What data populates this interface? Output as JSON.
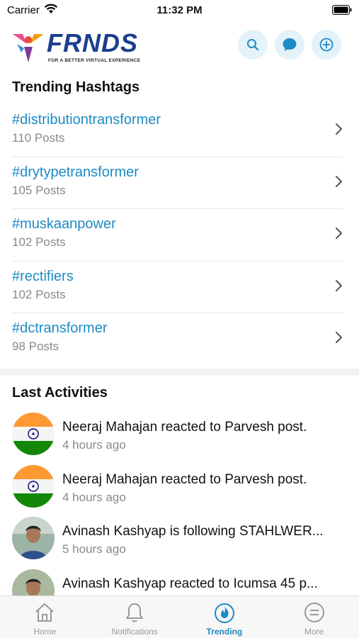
{
  "status_bar": {
    "carrier": "Carrier",
    "time": "11:32 PM"
  },
  "header": {
    "brand": "FRNDS",
    "tagline": "FOR A BETTER VIRTUAL EXPERIENCE",
    "actions": [
      "search-icon",
      "chat-icon",
      "add-circle-icon"
    ]
  },
  "trending": {
    "title": "Trending Hashtags",
    "items": [
      {
        "tag": "#distributiontransformer",
        "count": "110 Posts"
      },
      {
        "tag": "#drytypetransformer",
        "count": "105 Posts"
      },
      {
        "tag": "#muskaanpower",
        "count": "102 Posts"
      },
      {
        "tag": "#rectifiers",
        "count": "102 Posts"
      },
      {
        "tag": "#dctransformer",
        "count": "98 Posts"
      }
    ]
  },
  "activities": {
    "title": "Last Activities",
    "items": [
      {
        "text": "Neeraj Mahajan reacted to Parvesh post.",
        "time": "4 hours ago",
        "avatar": "india-flag"
      },
      {
        "text": "Neeraj Mahajan reacted to Parvesh post.",
        "time": "4 hours ago",
        "avatar": "india-flag"
      },
      {
        "text": "Avinash Kashyap is following STAHLWER...",
        "time": "5 hours ago",
        "avatar": "person-photo"
      },
      {
        "text": "Avinash Kashyap reacted to Icumsa 45 p...",
        "time": "",
        "avatar": "person-photo"
      }
    ]
  },
  "tab_bar": {
    "tabs": [
      {
        "label": "Home",
        "icon": "home-icon"
      },
      {
        "label": "Notifications",
        "icon": "bell-icon"
      },
      {
        "label": "Trending",
        "icon": "flame-icon"
      },
      {
        "label": "More",
        "icon": "more-icon"
      }
    ],
    "active": "Trending"
  },
  "colors": {
    "accent": "#1e8bc3",
    "brand": "#1b3f8f",
    "muted": "#8a8a8a"
  }
}
